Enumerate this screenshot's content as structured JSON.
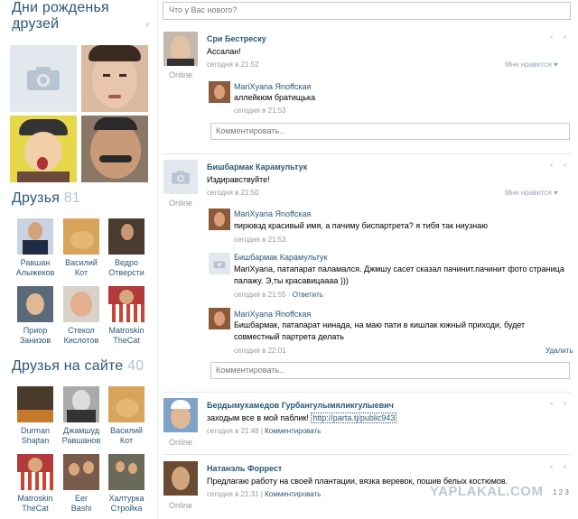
{
  "birthdays": {
    "title": "Дни рожденья друзей",
    "count": "4",
    "close": "×"
  },
  "friends": {
    "title": "Друзья",
    "count": "81",
    "items": [
      {
        "first": "Равшан",
        "last": "Алыжеков"
      },
      {
        "first": "Василий",
        "last": "Кот"
      },
      {
        "first": "Ведро",
        "last": "Отверсти"
      },
      {
        "first": "Приор",
        "last": "Занизов"
      },
      {
        "first": "Стекол",
        "last": "Кислотов"
      },
      {
        "first": "Matroskin",
        "last": "TheCat"
      }
    ]
  },
  "online_friends": {
    "title": "Друзья на сайте",
    "count": "40",
    "items": [
      {
        "first": "Durman",
        "last": "Shajtan"
      },
      {
        "first": "Джамшуд",
        "last": "Равшанов"
      },
      {
        "first": "Василий",
        "last": "Кот"
      },
      {
        "first": "Matroskin",
        "last": "TheCat"
      },
      {
        "first": "Ееr",
        "last": "Bashi"
      },
      {
        "first": "Халтурка",
        "last": "Стройка"
      }
    ]
  },
  "composer": {
    "placeholder": "Что у Вас нового?"
  },
  "labels": {
    "online": "Online",
    "like": "Мне нравится",
    "comment_placeholder": "Комментировать...",
    "delete": "Удалить",
    "reply": "Ответить",
    "comment_link": "Комментировать"
  },
  "posts": [
    {
      "author": "Сри Бестреску",
      "text": "Ассалан!",
      "time": "сегодня в 21:52",
      "comments": [
        {
          "author": "MariXyana Яnоffская",
          "text": "аллейкюм братищька",
          "time": "сегодня в 21:53"
        }
      ]
    },
    {
      "author": "Бишбармак Карамультук",
      "text": "Издиравствуйте!",
      "time": "сегодня в 21:50",
      "comments": [
        {
          "author": "MariXyana Яnоffская",
          "text": "пирювзд красивый имя, а пачиму биспартрета? я тибя так ниузнаю",
          "time": "сегодня в 21:53"
        },
        {
          "author": "Бишбармак Карамультук",
          "text": "MariXyana, патапарат паламался. Джмшу сасет сказал пачинит.пачинит фото страница палажу. Э,ты красавицаааа )))",
          "time": "сегодня в 21:55"
        },
        {
          "author": "MariXyana Яnоffская",
          "text": "Бишбармак, патапарат нинада, на маю пати в кишлак южный приходи, будет совместный партрета делать",
          "time": "сегодня в 22:01"
        }
      ]
    },
    {
      "author": "Бердымухамедов Гурбангулымяликгулыевич",
      "text": "заходым все в мой паблик!",
      "link": "http://parta.tj/public943",
      "time": "сегодня в 21:48"
    },
    {
      "author": "Натанэль Форрест",
      "text": "Предлагаю работу на своей плантации, вязка веревок, пошив белых костюмов.",
      "time": "сегодня в 21:31"
    }
  ],
  "watermark": "YAPLAKAL.COM",
  "pager": "1 2 3",
  "colors": {
    "link": "#2b587a",
    "muted": "#999999",
    "border": "#c0cad5",
    "count": "#b8c3cf"
  }
}
